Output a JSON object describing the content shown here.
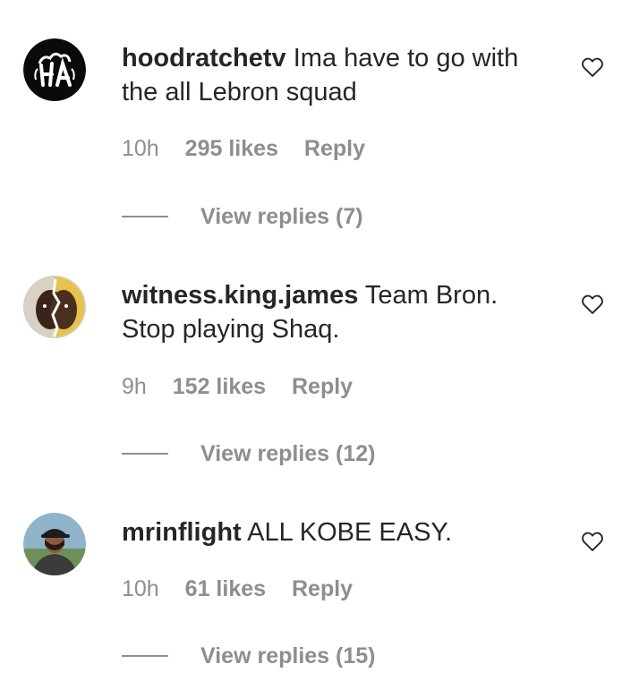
{
  "comments": [
    {
      "username": "hoodratchetv",
      "text": " Ima have to go with the all Lebron squad",
      "time": "10h",
      "likes": "295 likes",
      "reply_label": "Reply",
      "view_replies": "View replies (7)",
      "avatar_icon": "hoodratchet-logo-avatar"
    },
    {
      "username": "witness.king.james",
      "text": " Team Bron. Stop playing Shaq.",
      "time": "9h",
      "likes": "152 likes",
      "reply_label": "Reply",
      "view_replies": "View replies (12)",
      "avatar_icon": "split-face-avatar"
    },
    {
      "username": "mrinflight",
      "text": " ALL KOBE EASY.",
      "time": "10h",
      "likes": "61 likes",
      "reply_label": "Reply",
      "view_replies": "View replies (15)",
      "avatar_icon": "man-with-cap-avatar"
    }
  ],
  "colors": {
    "primary_text": "#262626",
    "secondary_text": "#8e8e8e",
    "background": "#ffffff"
  }
}
